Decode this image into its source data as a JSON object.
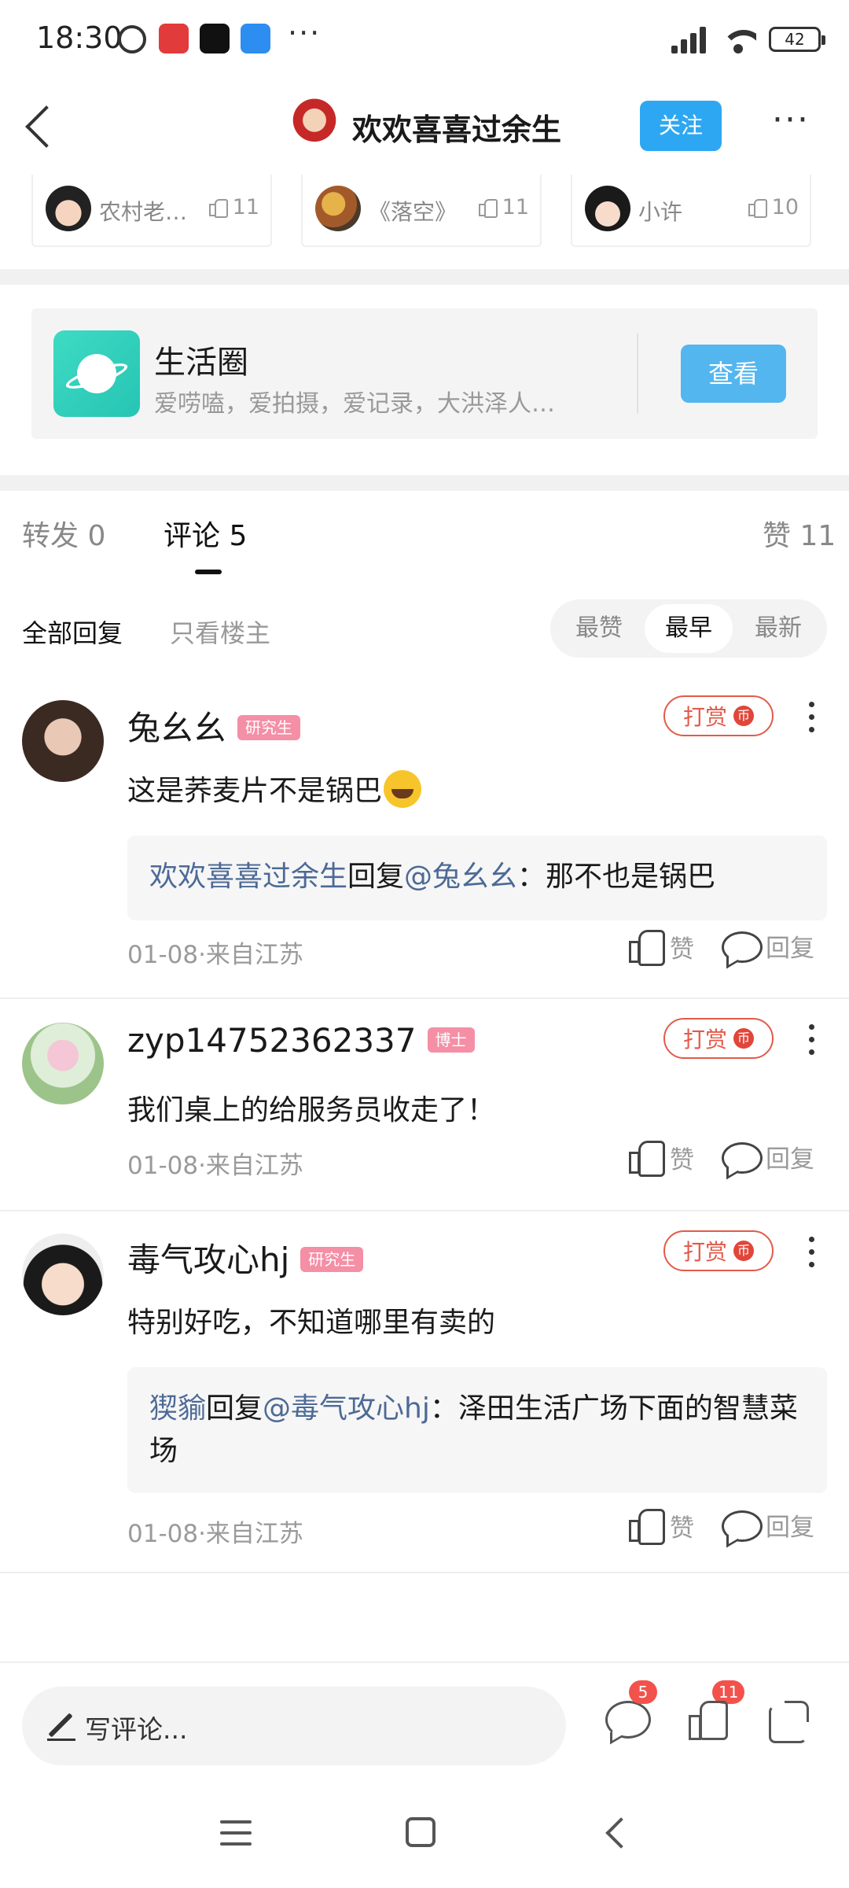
{
  "status_bar": {
    "time": "18:30",
    "icons": [
      "alarm-icon",
      "app-icon-red",
      "tiktok-icon",
      "app-icon-blue"
    ],
    "more": "···",
    "battery": "42",
    "network": "HD"
  },
  "header": {
    "title": "欢欢喜喜过余生",
    "follow_label": "关注",
    "more_label": "···"
  },
  "likers": [
    {
      "name": "农村老…",
      "likes": "11"
    },
    {
      "name": "《落空》",
      "likes": "11"
    },
    {
      "name": "小许",
      "likes": "10"
    }
  ],
  "circle": {
    "title": "生活圈",
    "desc": "爱唠嗑，爱拍摄，爱记录，大洪泽人…",
    "view_label": "查看"
  },
  "tabs": {
    "repost": "转发 0",
    "comment": "评论 5",
    "like": "赞 11"
  },
  "filters": {
    "all": "全部回复",
    "op_only": "只看楼主",
    "sort": [
      "最赞",
      "最早",
      "最新"
    ],
    "active_sort": "最早"
  },
  "comments": [
    {
      "name": "兔幺幺",
      "badge": "研究生",
      "text": "这是荞麦片不是锅巴",
      "reward_label": "打赏",
      "reply": {
        "from": "欢欢喜喜过余生",
        "verb": "回复",
        "to": "@兔幺幺",
        "text": "：那不也是锅巴"
      },
      "meta": "01-08·来自江苏",
      "like_label": "赞",
      "reply_label": "回复"
    },
    {
      "name": "zyp14752362337",
      "badge": "博士",
      "text": "我们桌上的给服务员收走了！",
      "reward_label": "打赏",
      "meta": "01-08·来自江苏",
      "like_label": "赞",
      "reply_label": "回复"
    },
    {
      "name": "毒气攻心hj",
      "badge": "研究生",
      "text": "特别好吃，不知道哪里有卖的",
      "reward_label": "打赏",
      "reply": {
        "from": "猰貐",
        "verb": "回复",
        "to": "@毒气攻心hj",
        "text": "：泽田生活广场下面的智慧菜场"
      },
      "meta": "01-08·来自江苏",
      "like_label": "赞",
      "reply_label": "回复"
    }
  ],
  "bottom_bar": {
    "write_placeholder": "写评论...",
    "comment_count": "5",
    "like_count": "11"
  },
  "colors": {
    "accent_blue": "#2ea7f2",
    "link": "#4d6a96",
    "reward_red": "#e25a4a",
    "badge_pink": "#f48fa6"
  }
}
